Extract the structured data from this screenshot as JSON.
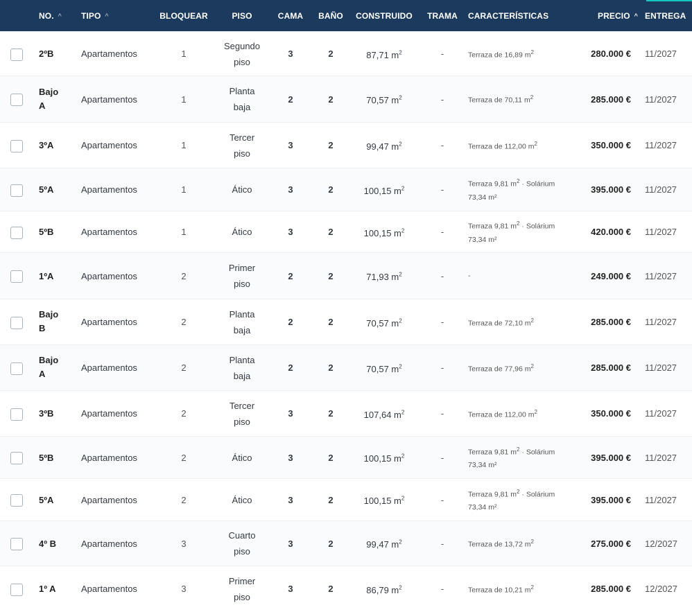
{
  "header": {
    "no": "NO.",
    "tipo": "TIPO",
    "bloquear": "BLOQUEAR",
    "piso": "PISO",
    "cama": "CAMA",
    "bano": "BAÑO",
    "construido": "CONSTRUIDO",
    "trama": "TRAMA",
    "caracteristicas": "CARACTERÍSTICAS",
    "precio": "PRECIO",
    "entrega": "ENTREGA"
  },
  "icons": {
    "sort_up": "▲-sort-icon",
    "sort_caret": "^"
  },
  "rows": [
    {
      "no": "2ºB",
      "tipo": "Apartamentos",
      "bloquear": "1",
      "piso": "Segundo piso",
      "cama": "3",
      "bano": "2",
      "construido": "87,71 m²",
      "trama": "-",
      "caracteristicas": "Terraza de 16,89 m²",
      "precio": "280.000 €",
      "entrega": "11/2027",
      "height": 64
    },
    {
      "no": "Bajo A",
      "tipo": "Apartamentos",
      "bloquear": "1",
      "piso": "Planta baja",
      "cama": "2",
      "bano": "2",
      "construido": "70,57 m²",
      "trama": "-",
      "caracteristicas": "Terraza de 70,11 m²",
      "precio": "285.000 €",
      "entrega": "11/2027",
      "height": 67
    },
    {
      "no": "3ºA",
      "tipo": "Apartamentos",
      "bloquear": "1",
      "piso": "Tercer piso",
      "cama": "3",
      "bano": "2",
      "construido": "99,47 m²",
      "trama": "-",
      "caracteristicas": "Terraza de 112,00 m²",
      "precio": "350.000 €",
      "entrega": "11/2027",
      "height": 66
    },
    {
      "no": "5ºA",
      "tipo": "Apartamentos",
      "bloquear": "1",
      "piso": "Ático",
      "cama": "3",
      "bano": "2",
      "construido": "100,15 m²",
      "trama": "-",
      "caracteristicas": "Terraza 9,81 m² · Solárium 73,34 m²",
      "precio": "395.000 €",
      "entrega": "11/2027",
      "height": 62
    },
    {
      "no": "5ºB",
      "tipo": "Apartamentos",
      "bloquear": "1",
      "piso": "Ático",
      "cama": "3",
      "bano": "2",
      "construido": "100,15 m²",
      "trama": "-",
      "caracteristicas": "Terraza 9,81 m² · Solárium 73,34 m²",
      "precio": "420.000 €",
      "entrega": "11/2027",
      "height": 60
    },
    {
      "no": "1ºA",
      "tipo": "Apartamentos",
      "bloquear": "2",
      "piso": "Primer piso",
      "cama": "2",
      "bano": "2",
      "construido": "71,93 m²",
      "trama": "-",
      "caracteristicas": "-",
      "precio": "249.000 €",
      "entrega": "11/2027",
      "height": 67
    },
    {
      "no": "Bajo B",
      "tipo": "Apartamentos",
      "bloquear": "2",
      "piso": "Planta baja",
      "cama": "2",
      "bano": "2",
      "construido": "70,57 m²",
      "trama": "-",
      "caracteristicas": "Terraza de 72,10 m²",
      "precio": "285.000 €",
      "entrega": "11/2027",
      "height": 66
    },
    {
      "no": "Bajo A",
      "tipo": "Apartamentos",
      "bloquear": "2",
      "piso": "Planta baja",
      "cama": "2",
      "bano": "2",
      "construido": "70,57 m²",
      "trama": "-",
      "caracteristicas": "Terraza de 77,96 m²",
      "precio": "285.000 €",
      "entrega": "11/2027",
      "height": 66
    },
    {
      "no": "3ºB",
      "tipo": "Apartamentos",
      "bloquear": "2",
      "piso": "Tercer piso",
      "cama": "3",
      "bano": "2",
      "construido": "107,64 m²",
      "trama": "-",
      "caracteristicas": "Terraza de 112,00 m²",
      "precio": "350.000 €",
      "entrega": "11/2027",
      "height": 66
    },
    {
      "no": "5ºB",
      "tipo": "Apartamentos",
      "bloquear": "2",
      "piso": "Ático",
      "cama": "3",
      "bano": "2",
      "construido": "100,15 m²",
      "trama": "-",
      "caracteristicas": "Terraza 9,81 m² · Solárium 73,34 m²",
      "precio": "395.000 €",
      "entrega": "11/2027",
      "height": 61
    },
    {
      "no": "5ºA",
      "tipo": "Apartamentos",
      "bloquear": "2",
      "piso": "Ático",
      "cama": "3",
      "bano": "2",
      "construido": "100,15 m²",
      "trama": "-",
      "caracteristicas": "Terraza 9,81 m² · Solárium 73,34 m²",
      "precio": "395.000 €",
      "entrega": "11/2027",
      "height": 61
    },
    {
      "no": "4º B",
      "tipo": "Apartamentos",
      "bloquear": "3",
      "piso": "Cuarto piso",
      "cama": "3",
      "bano": "2",
      "construido": "99,47 m²",
      "trama": "-",
      "caracteristicas": "Terraza de 13,72 m²",
      "precio": "275.000 €",
      "entrega": "12/2027",
      "height": 65
    },
    {
      "no": "1º A",
      "tipo": "Apartamentos",
      "bloquear": "3",
      "piso": "Primer piso",
      "cama": "3",
      "bano": "2",
      "construido": "86,79 m²",
      "trama": "-",
      "caracteristicas": "Terraza de 10,21 m²",
      "precio": "285.000 €",
      "entrega": "12/2027",
      "height": 66
    }
  ]
}
